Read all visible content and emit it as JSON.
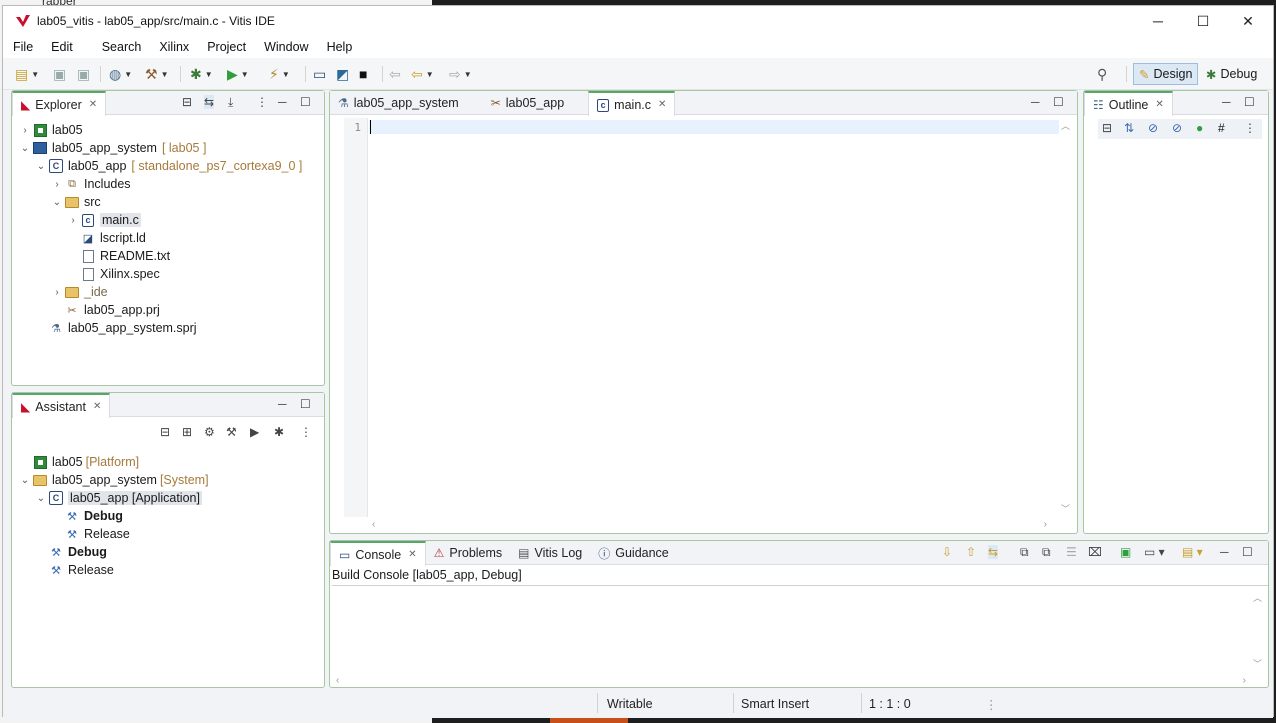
{
  "window": {
    "title": "lab05_vitis - lab05_app/src/main.c - Vitis IDE",
    "controls": {
      "minimize": "─",
      "maximize": "☐",
      "close": "✕"
    }
  },
  "background": {
    "partial_text": "rapper"
  },
  "menu": [
    "File",
    "Edit",
    "Search",
    "Xilinx",
    "Project",
    "Window",
    "Help"
  ],
  "perspectives": {
    "design": "Design",
    "debug": "Debug"
  },
  "explorer": {
    "tab": "Explorer",
    "items": [
      {
        "label": "lab05",
        "decoration": ""
      },
      {
        "label": "lab05_app_system",
        "decoration": "[ lab05 ]"
      },
      {
        "label": "lab05_app",
        "decoration": "[ standalone_ps7_cortexa9_0 ]"
      },
      {
        "label": "Includes",
        "decoration": ""
      },
      {
        "label": "src",
        "decoration": ""
      },
      {
        "label": "main.c",
        "decoration": ""
      },
      {
        "label": "lscript.ld",
        "decoration": ""
      },
      {
        "label": "README.txt",
        "decoration": ""
      },
      {
        "label": "Xilinx.spec",
        "decoration": ""
      },
      {
        "label": "_ide",
        "decoration": ""
      },
      {
        "label": "lab05_app.prj",
        "decoration": ""
      },
      {
        "label": "lab05_app_system.sprj",
        "decoration": ""
      }
    ]
  },
  "assistant": {
    "tab": "Assistant",
    "items": [
      {
        "label": "lab05",
        "decoration": "[Platform]"
      },
      {
        "label": "lab05_app_system",
        "decoration": "[System]"
      },
      {
        "label": "lab05_app [Application]",
        "decoration": ""
      },
      {
        "label": "Debug",
        "decoration": ""
      },
      {
        "label": "Release",
        "decoration": ""
      },
      {
        "label": "Debug",
        "decoration": ""
      },
      {
        "label": "Release",
        "decoration": ""
      }
    ]
  },
  "editor": {
    "tabs": [
      "lab05_app_system",
      "lab05_app",
      "main.c"
    ],
    "active_tab": "main.c",
    "line_numbers": [
      "1"
    ]
  },
  "outline": {
    "tab": "Outline"
  },
  "bottom": {
    "tabs": [
      "Console",
      "Problems",
      "Vitis Log",
      "Guidance"
    ],
    "active_tab": "Console",
    "console_title": "Build Console [lab05_app, Debug]"
  },
  "status": {
    "mode": "Writable",
    "insert": "Smart Insert",
    "position": "1 : 1 : 0"
  }
}
